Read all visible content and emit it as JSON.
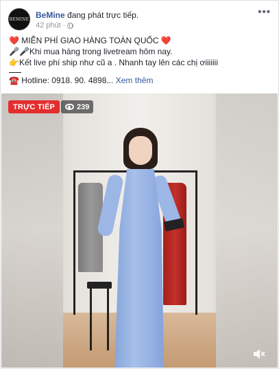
{
  "post": {
    "page_name": "BeMine",
    "action_text": " đang phát trực tiếp.",
    "avatar_text": "BEMINE",
    "time": "42 phút",
    "dot": "·",
    "more_label": "•••"
  },
  "body": {
    "line1_prefix": "❤️",
    "line1_text": " MIỄN PHÍ GIAO HÀNG TOÀN QUỐC ",
    "line1_suffix": "❤️",
    "line2_prefix": "🎤🎤",
    "line2_text": "Khi mua hàng trong livetream hôm nay.",
    "line3_prefix": "👉",
    "line3_text": "Kết live phí ship như cũ a . Nhanh tay lên các chị ơiiiiiii",
    "line4_prefix": "☎️",
    "line4_text": " Hotline: 0918. 90. 4898",
    "ellipsis": "...",
    "see_more": "Xem thêm"
  },
  "video": {
    "live_label": "TRỰC TIẾP",
    "viewer_count": "239"
  },
  "colors": {
    "live_red": "#e42d2d",
    "link_blue": "#365899"
  }
}
